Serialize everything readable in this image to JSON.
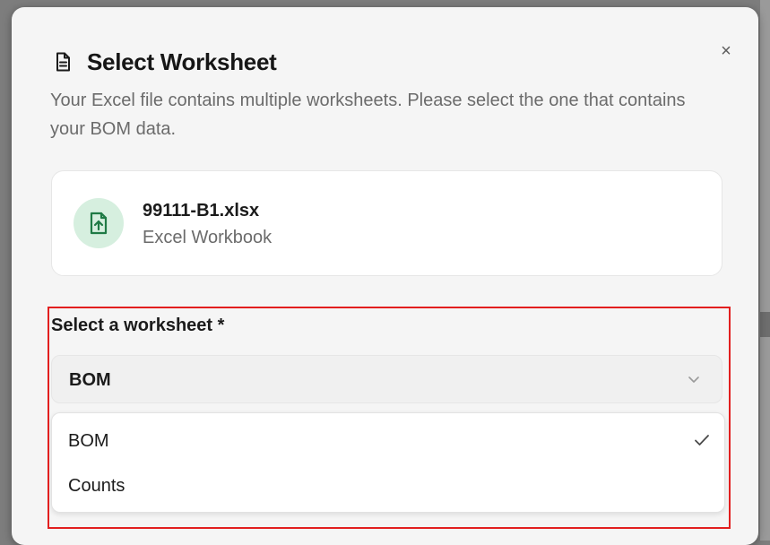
{
  "dialog": {
    "title": "Select Worksheet",
    "description": "Your Excel file contains multiple worksheets. Please select the one that contains your BOM data.",
    "close_symbol": "×"
  },
  "file": {
    "name": "99111-B1.xlsx",
    "type": "Excel Workbook",
    "icon": "file-upload-icon"
  },
  "worksheet_select": {
    "label": "Select a worksheet *",
    "selected": "BOM",
    "options": [
      {
        "label": "BOM",
        "checked": true
      },
      {
        "label": "Counts",
        "checked": false
      }
    ]
  },
  "colors": {
    "highlight_border": "#e21f1f",
    "file_icon_bg": "#d6efdf",
    "file_icon_fg": "#1f7a45"
  }
}
